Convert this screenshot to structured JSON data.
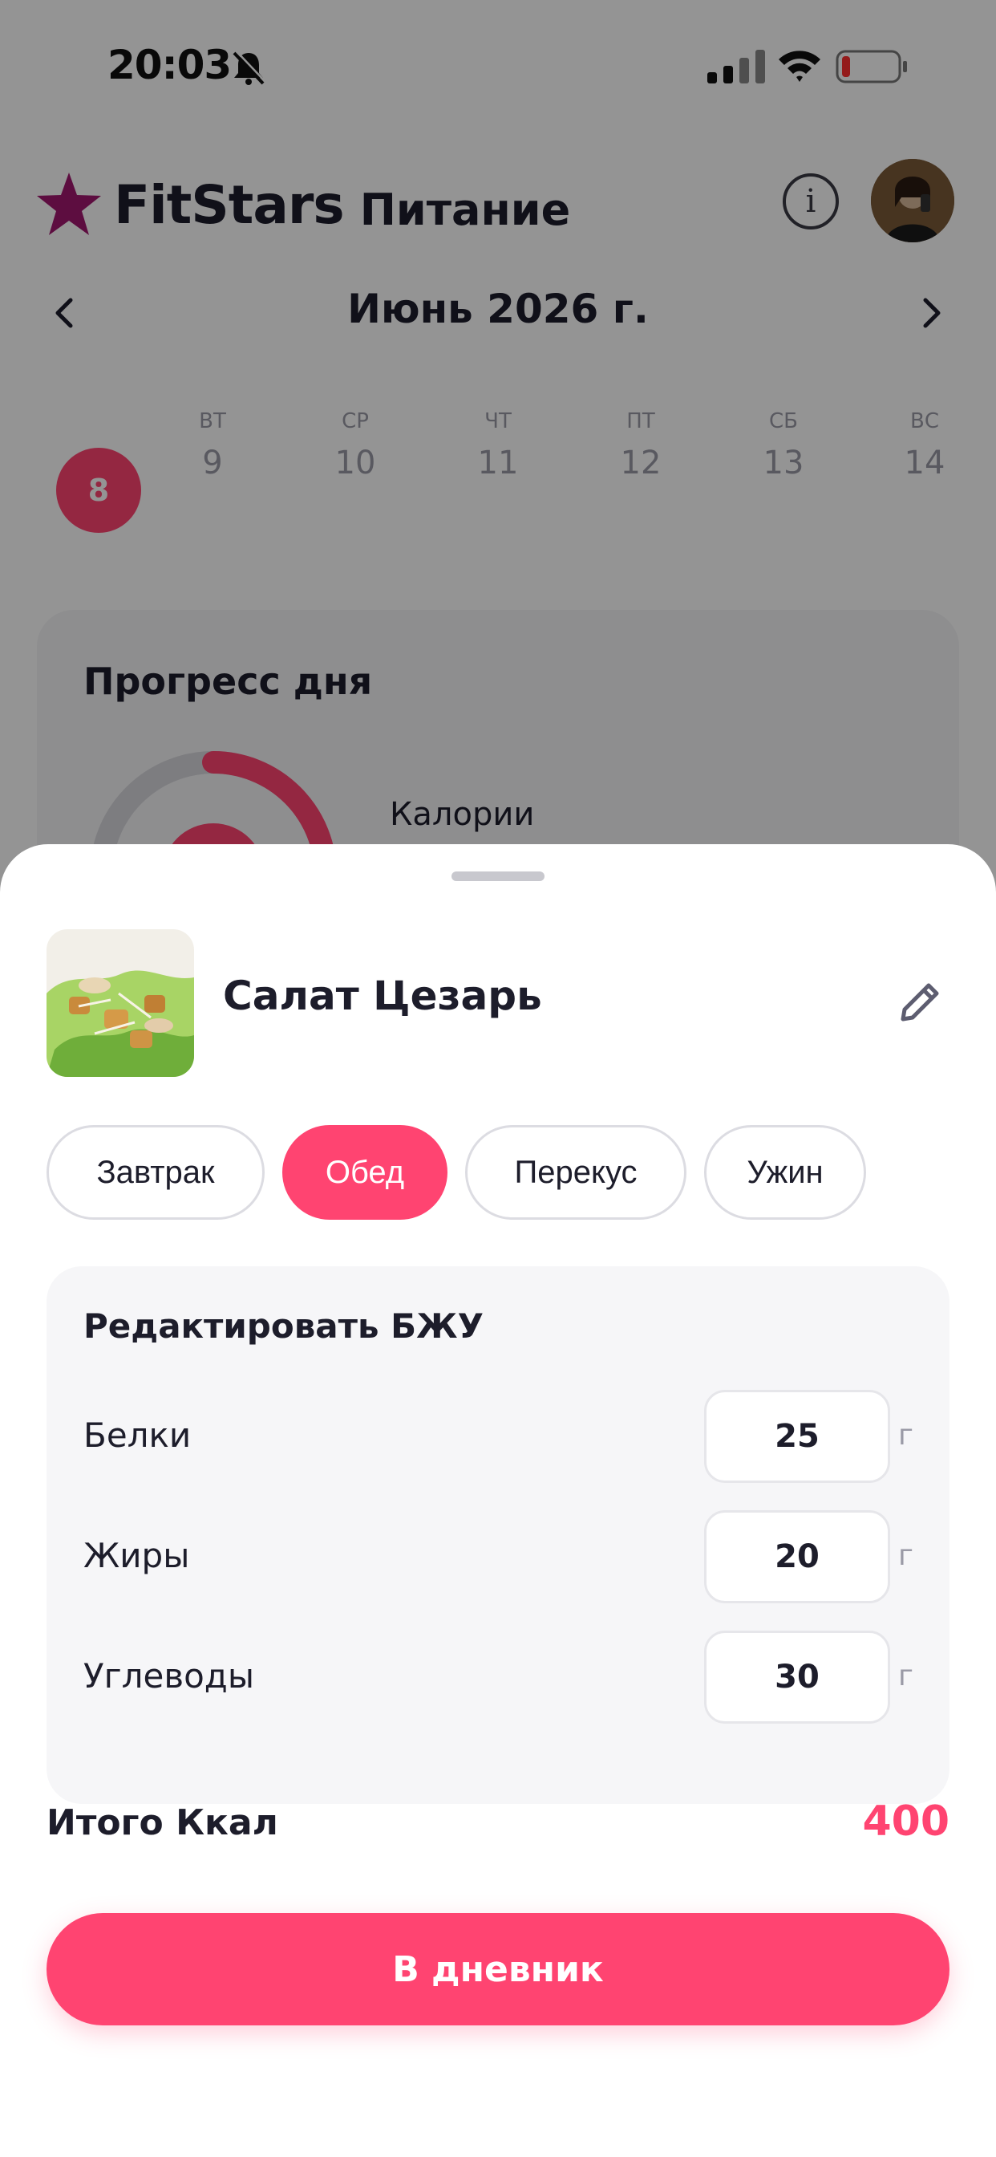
{
  "status_bar": {
    "time": "20:03"
  },
  "brand": {
    "name": "FitStars",
    "section": "Питание"
  },
  "calendar": {
    "month": "Июнь 2026 г.",
    "days": [
      {
        "name": "",
        "number": "8",
        "active": true
      },
      {
        "name": "ВТ",
        "number": "9"
      },
      {
        "name": "СР",
        "number": "10"
      },
      {
        "name": "ЧТ",
        "number": "11"
      },
      {
        "name": "ПТ",
        "number": "12"
      },
      {
        "name": "СБ",
        "number": "13"
      },
      {
        "name": "ВС",
        "number": "14"
      }
    ]
  },
  "progress": {
    "title": "Прогресс дня",
    "calories_label": "Калории"
  },
  "sheet": {
    "food_name": "Салат Цезарь",
    "meal_types": [
      {
        "label": "Завтрак",
        "selected": false
      },
      {
        "label": "Обед",
        "selected": true
      },
      {
        "label": "Перекус",
        "selected": false
      },
      {
        "label": "Ужин",
        "selected": false
      }
    ],
    "macros": {
      "title": "Редактировать БЖУ",
      "rows": [
        {
          "label": "Белки",
          "value": "25",
          "unit": "г"
        },
        {
          "label": "Жиры",
          "value": "20",
          "unit": "г"
        },
        {
          "label": "Углеводы",
          "value": "30",
          "unit": "г"
        }
      ]
    },
    "total_label": "Итого Ккал",
    "total_value": "400",
    "cta_label": "В дневник"
  },
  "colors": {
    "accent": "#ff4471",
    "text": "#1d1d2b",
    "brand_star": "#a0186e"
  },
  "icons": [
    "bell-off-icon",
    "signal-icon",
    "wifi-icon",
    "battery-icon",
    "star-logo-icon",
    "info-icon",
    "chevron-left-icon",
    "chevron-right-icon",
    "pencil-icon"
  ]
}
